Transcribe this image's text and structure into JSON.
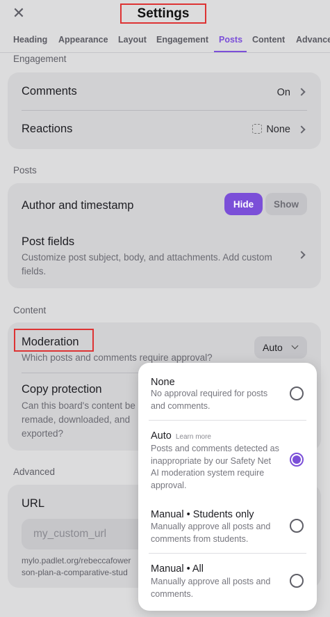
{
  "header": {
    "close_icon": "close-icon",
    "title": "Settings"
  },
  "tabs": [
    "Heading",
    "Appearance",
    "Layout",
    "Engagement",
    "Posts",
    "Content",
    "Advanced"
  ],
  "active_tab": "Posts",
  "engagement": {
    "label": "Engagement",
    "comments": {
      "title": "Comments",
      "value": "On"
    },
    "reactions": {
      "title": "Reactions",
      "value": "None"
    }
  },
  "posts": {
    "label": "Posts",
    "author": {
      "title": "Author and timestamp",
      "hide_label": "Hide",
      "show_label": "Show"
    },
    "fields": {
      "title": "Post fields",
      "desc": "Customize post subject, body, and attachments. Add custom fields."
    }
  },
  "content": {
    "label": "Content",
    "moderation": {
      "title": "Moderation",
      "desc": "Which posts and comments require approval?",
      "value": "Auto"
    },
    "copy": {
      "title": "Copy protection",
      "desc_lines": [
        "Can this board's content be",
        "remade, downloaded, and",
        "exported?"
      ]
    }
  },
  "advanced": {
    "label": "Advanced",
    "url": {
      "title": "URL",
      "placeholder": "my_custom_url",
      "link_lines": [
        "mylo.padlet.org/rebeccafower",
        "son-plan-a-comparative-stud"
      ]
    }
  },
  "moderation_menu": {
    "options": [
      {
        "title": "None",
        "extra": "",
        "desc": "No approval required for posts and comments.",
        "selected": false
      },
      {
        "title": "Auto",
        "extra": "Learn more",
        "desc": "Posts and comments detected as inappropriate by our Safety Net AI moderation system require approval.",
        "selected": true
      },
      {
        "title": "Manual • Students only",
        "extra": "",
        "desc": "Manually approve all posts and comments from students.",
        "selected": false
      },
      {
        "title": "Manual • All",
        "extra": "",
        "desc": "Manually approve all posts and comments.",
        "selected": false
      }
    ]
  },
  "colors": {
    "accent": "#7b4fd8",
    "highlight_box": "#dd3333",
    "background": "#dcdcdd"
  }
}
